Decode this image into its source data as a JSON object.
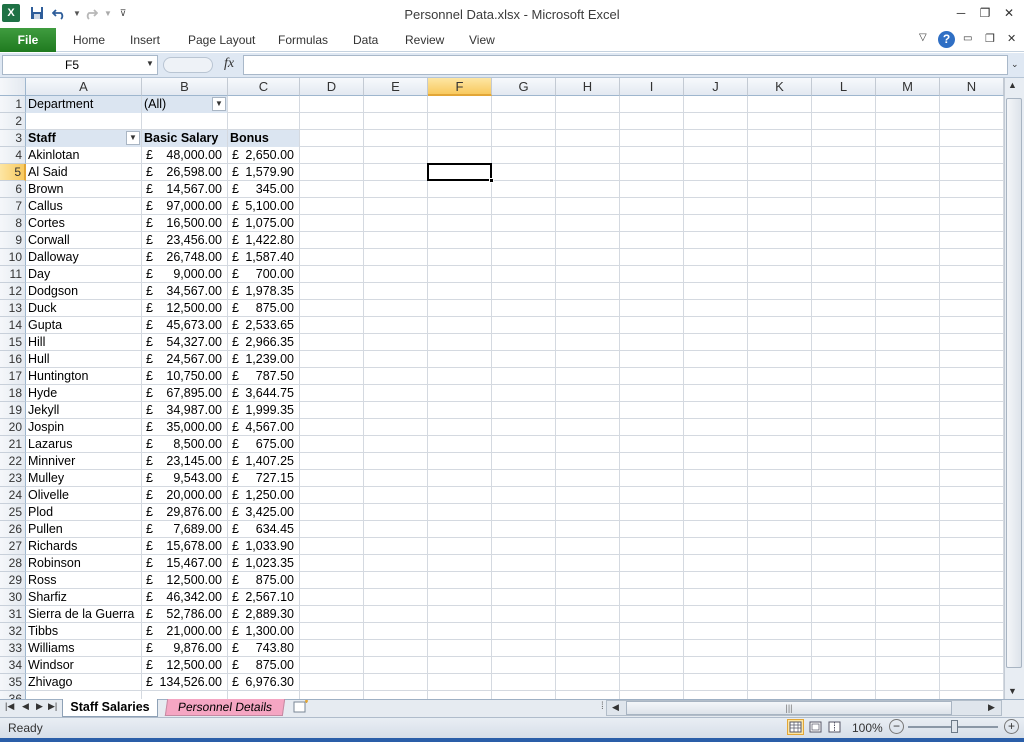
{
  "window": {
    "title": "Personnel Data.xlsx  -  Microsoft Excel",
    "app_icon": "X",
    "controls": {
      "minimize": "─",
      "restore": "❐",
      "close": "✕"
    }
  },
  "ribbon": {
    "file": "File",
    "tabs": [
      "Home",
      "Insert",
      "Page Layout",
      "Formulas",
      "Data",
      "Review",
      "View"
    ]
  },
  "formula_bar": {
    "name_box": "F5",
    "fx": "fx",
    "value": ""
  },
  "columns": [
    "A",
    "B",
    "C",
    "D",
    "E",
    "F",
    "G",
    "H",
    "I",
    "J",
    "K",
    "L",
    "M",
    "N"
  ],
  "selected_column": "F",
  "selected_row": 5,
  "pivot": {
    "filter_label": "Department",
    "filter_value": "(All)",
    "headers": {
      "staff": "Staff",
      "salary": "Basic Salary",
      "bonus": "Bonus"
    },
    "currency": "£",
    "rows": [
      {
        "staff": "Akinlotan",
        "salary": "48,000.00",
        "bonus": "2,650.00"
      },
      {
        "staff": "Al Said",
        "salary": "26,598.00",
        "bonus": "1,579.90"
      },
      {
        "staff": "Brown",
        "salary": "14,567.00",
        "bonus": "345.00"
      },
      {
        "staff": "Callus",
        "salary": "97,000.00",
        "bonus": "5,100.00"
      },
      {
        "staff": "Cortes",
        "salary": "16,500.00",
        "bonus": "1,075.00"
      },
      {
        "staff": "Corwall",
        "salary": "23,456.00",
        "bonus": "1,422.80"
      },
      {
        "staff": "Dalloway",
        "salary": "26,748.00",
        "bonus": "1,587.40"
      },
      {
        "staff": "Day",
        "salary": "9,000.00",
        "bonus": "700.00"
      },
      {
        "staff": "Dodgson",
        "salary": "34,567.00",
        "bonus": "1,978.35"
      },
      {
        "staff": "Duck",
        "salary": "12,500.00",
        "bonus": "875.00"
      },
      {
        "staff": "Gupta",
        "salary": "45,673.00",
        "bonus": "2,533.65"
      },
      {
        "staff": "Hill",
        "salary": "54,327.00",
        "bonus": "2,966.35"
      },
      {
        "staff": "Hull",
        "salary": "24,567.00",
        "bonus": "1,239.00"
      },
      {
        "staff": "Huntington",
        "salary": "10,750.00",
        "bonus": "787.50"
      },
      {
        "staff": "Hyde",
        "salary": "67,895.00",
        "bonus": "3,644.75"
      },
      {
        "staff": "Jekyll",
        "salary": "34,987.00",
        "bonus": "1,999.35"
      },
      {
        "staff": "Jospin",
        "salary": "35,000.00",
        "bonus": "4,567.00"
      },
      {
        "staff": "Lazarus",
        "salary": "8,500.00",
        "bonus": "675.00"
      },
      {
        "staff": "Minniver",
        "salary": "23,145.00",
        "bonus": "1,407.25"
      },
      {
        "staff": "Mulley",
        "salary": "9,543.00",
        "bonus": "727.15"
      },
      {
        "staff": "Olivelle",
        "salary": "20,000.00",
        "bonus": "1,250.00"
      },
      {
        "staff": "Plod",
        "salary": "29,876.00",
        "bonus": "3,425.00"
      },
      {
        "staff": "Pullen",
        "salary": "7,689.00",
        "bonus": "634.45"
      },
      {
        "staff": "Richards",
        "salary": "15,678.00",
        "bonus": "1,033.90"
      },
      {
        "staff": "Robinson",
        "salary": "15,467.00",
        "bonus": "1,023.35"
      },
      {
        "staff": "Ross",
        "salary": "12,500.00",
        "bonus": "875.00"
      },
      {
        "staff": "Sharfiz",
        "salary": "46,342.00",
        "bonus": "2,567.10"
      },
      {
        "staff": "Sierra de la Guerra",
        "salary": "52,786.00",
        "bonus": "2,889.30"
      },
      {
        "staff": "Tibbs",
        "salary": "21,000.00",
        "bonus": "1,300.00"
      },
      {
        "staff": "Williams",
        "salary": "9,876.00",
        "bonus": "743.80"
      },
      {
        "staff": "Windsor",
        "salary": "12,500.00",
        "bonus": "875.00"
      },
      {
        "staff": "Zhivago",
        "salary": "134,526.00",
        "bonus": "6,976.30"
      }
    ]
  },
  "sheet_tabs": [
    "Staff Salaries",
    "Personnel Details"
  ],
  "active_sheet": "Staff Salaries",
  "status": {
    "text": "Ready",
    "zoom": "100%"
  }
}
